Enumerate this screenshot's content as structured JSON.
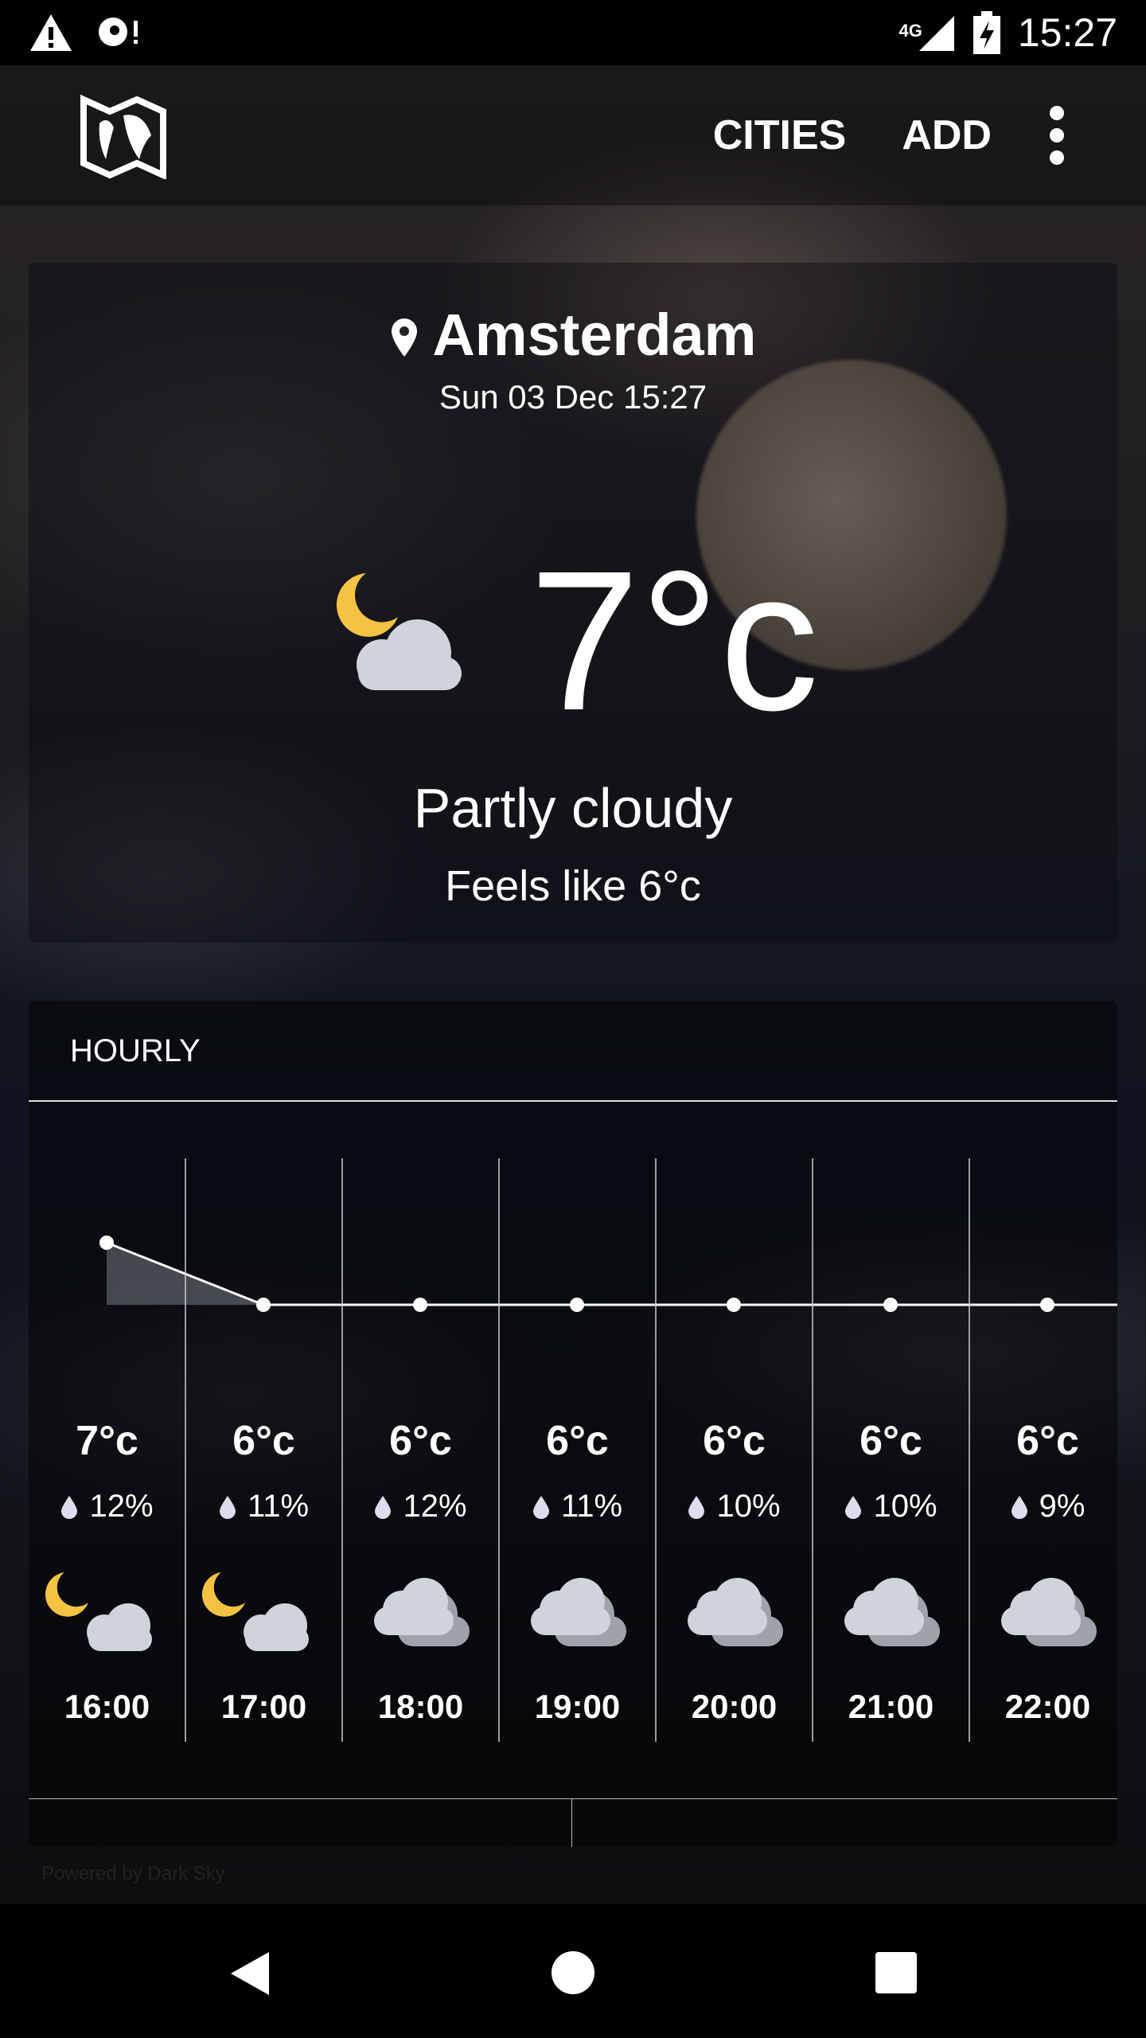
{
  "status_bar": {
    "time": "15:27",
    "network": "4G",
    "icons": [
      "warning-icon",
      "sync-alert-icon",
      "signal-icon",
      "battery-charging-icon"
    ]
  },
  "toolbar": {
    "logo": "world-map-icon",
    "cities_label": "CITIES",
    "add_label": "ADD",
    "menu": "more-vert-icon"
  },
  "current": {
    "city": "Amsterdam",
    "datetime": "Sun 03 Dec 15:27",
    "temperature": "7°c",
    "summary": "Partly cloudy",
    "feels_like": "Feels like 6°c",
    "icon": "partly-cloudy-night-icon"
  },
  "hourly": {
    "title": "HOURLY",
    "items": [
      {
        "time": "16:00",
        "temp": "7°c",
        "temp_value": 7,
        "precip": "12%",
        "icon": "partly-cloudy-night"
      },
      {
        "time": "17:00",
        "temp": "6°c",
        "temp_value": 6,
        "precip": "11%",
        "icon": "partly-cloudy-night"
      },
      {
        "time": "18:00",
        "temp": "6°c",
        "temp_value": 6,
        "precip": "12%",
        "icon": "cloudy"
      },
      {
        "time": "19:00",
        "temp": "6°c",
        "temp_value": 6,
        "precip": "11%",
        "icon": "cloudy"
      },
      {
        "time": "20:00",
        "temp": "6°c",
        "temp_value": 6,
        "precip": "10%",
        "icon": "cloudy"
      },
      {
        "time": "21:00",
        "temp": "6°c",
        "temp_value": 6,
        "precip": "10%",
        "icon": "cloudy"
      },
      {
        "time": "22:00",
        "temp": "6°c",
        "temp_value": 6,
        "precip": "9%",
        "icon": "cloudy"
      }
    ]
  },
  "footer": {
    "powered_by": "Powered by Dark Sky"
  },
  "colors": {
    "moon_icon": "#f5c242",
    "cloud_icon": "#cfd3da"
  }
}
